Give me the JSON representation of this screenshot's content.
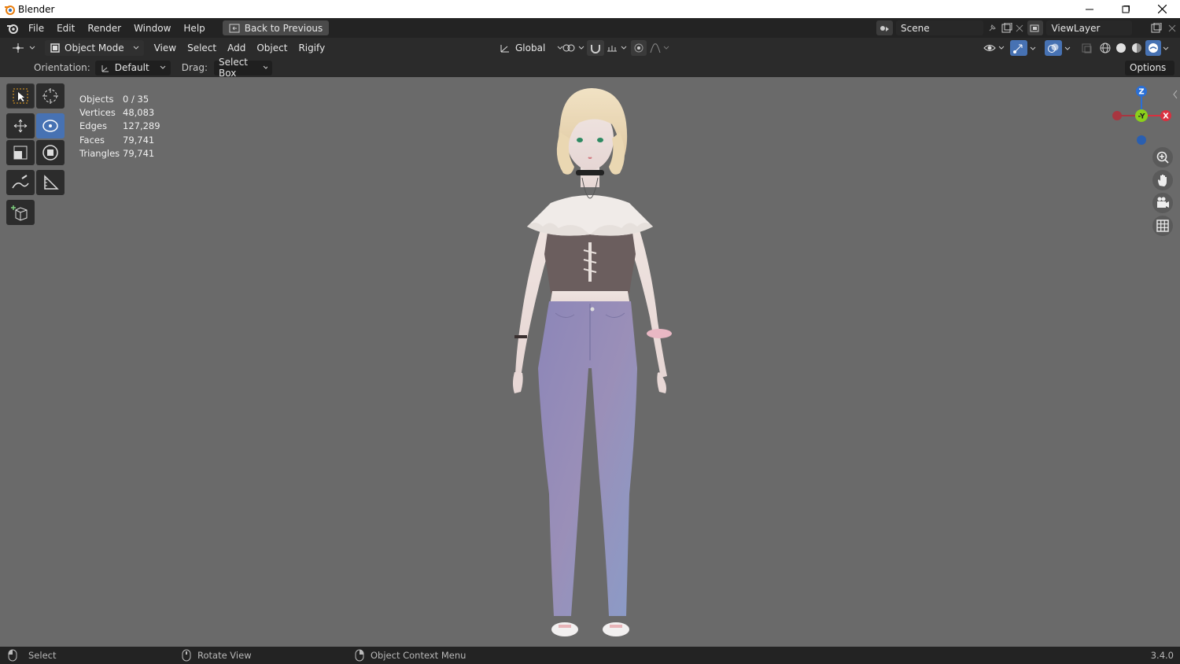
{
  "window": {
    "title": "Blender"
  },
  "topbar": {
    "menus": [
      "File",
      "Edit",
      "Render",
      "Window",
      "Help"
    ],
    "back_button": "Back to Previous",
    "scene": "Scene",
    "view_layer": "ViewLayer"
  },
  "header": {
    "mode": "Object Mode",
    "menus": [
      "View",
      "Select",
      "Add",
      "Object",
      "Rigify"
    ],
    "transform_orientation": "Global"
  },
  "tool_settings": {
    "orientation_label": "Orientation:",
    "orientation_value": "Default",
    "drag_label": "Drag:",
    "drag_value": "Select Box",
    "options_label": "Options"
  },
  "stats": [
    {
      "label": "Objects",
      "value": "0 / 35"
    },
    {
      "label": "Vertices",
      "value": "48,083"
    },
    {
      "label": "Edges",
      "value": "127,289"
    },
    {
      "label": "Faces",
      "value": "79,741"
    },
    {
      "label": "Triangles",
      "value": "79,741"
    }
  ],
  "gizmo": {
    "z": "Z",
    "y": "-Y",
    "x": "X"
  },
  "statusbar": {
    "select": "Select",
    "rotate": "Rotate View",
    "context": "Object Context Menu",
    "version": "3.4.0"
  },
  "colors": {
    "accent": "#4772b3",
    "viewport_bg": "#6a6a6a",
    "axis_x": "#d9303f",
    "axis_y": "#8bd01a",
    "axis_z": "#2a6fd6"
  },
  "icons": [
    "blender-logo-icon",
    "minimize-icon",
    "maximize-icon",
    "close-icon",
    "select-box-icon",
    "cursor-icon",
    "move-icon",
    "rotate-icon",
    "scale-icon",
    "transform-icon",
    "annotate-icon",
    "measure-icon",
    "add-cube-icon",
    "zoom-icon",
    "pan-hand-icon",
    "camera-icon",
    "grid-icon",
    "mouse-left-icon",
    "mouse-middle-icon",
    "mouse-right-icon"
  ]
}
